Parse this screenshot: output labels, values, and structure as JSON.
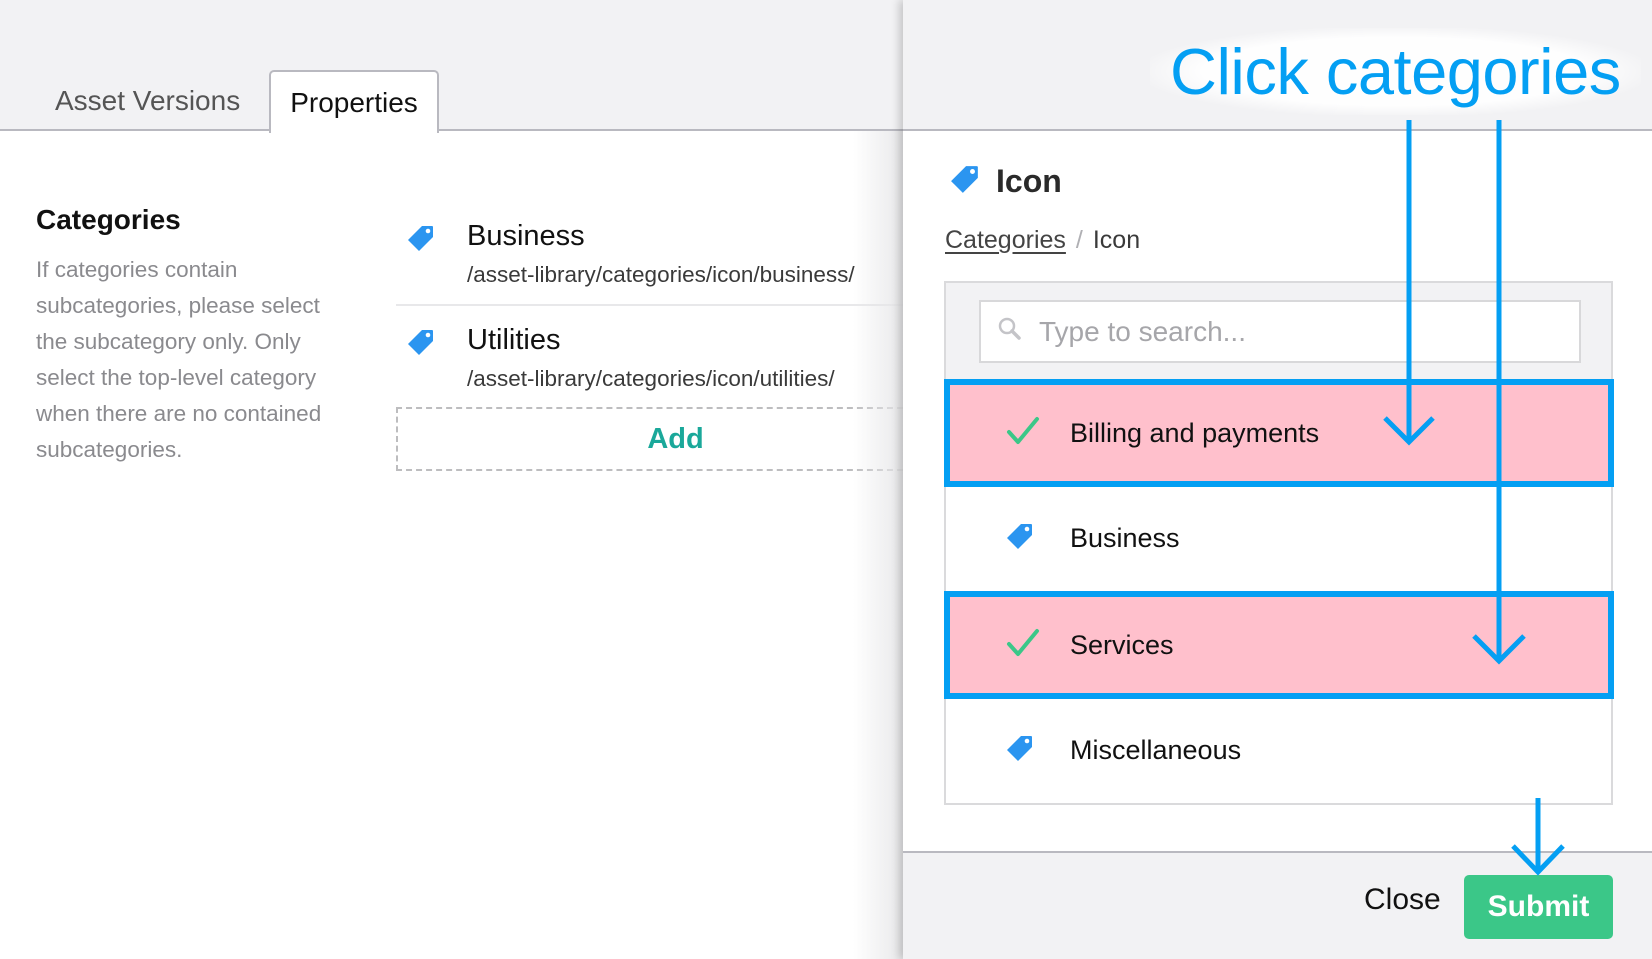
{
  "tabs": [
    {
      "label": "Asset Versions",
      "active": false
    },
    {
      "label": "Properties",
      "active": true
    }
  ],
  "categories_section": {
    "title": "Categories",
    "help_text": "If categories contain subcategories, please select the subcategory only. Only select the top-level category when there are no contained subcategories.",
    "assigned": [
      {
        "name": "Business",
        "path": "/asset-library/categories/icon/business/",
        "icon": "tag-icon"
      },
      {
        "name": "Utilities",
        "path": "/asset-library/categories/icon/utilities/",
        "icon": "tag-icon"
      }
    ],
    "add_label": "Add"
  },
  "drawer": {
    "title": "Icon",
    "title_icon": "tag-icon",
    "breadcrumb": [
      {
        "label": "Categories",
        "link": true
      },
      {
        "label": "Icon",
        "link": false
      }
    ],
    "breadcrumb_separator": "/",
    "search": {
      "placeholder": "Type to search...",
      "value": ""
    },
    "items": [
      {
        "label": "Billing and payments",
        "selected": true,
        "icon": "check-icon"
      },
      {
        "label": "Business",
        "selected": false,
        "icon": "tag-icon"
      },
      {
        "label": "Services",
        "selected": true,
        "icon": "check-icon"
      },
      {
        "label": "Miscellaneous",
        "selected": false,
        "icon": "tag-icon"
      }
    ],
    "close_label": "Close",
    "submit_label": "Submit"
  },
  "annotation": {
    "text": "Click categories"
  },
  "colors": {
    "accent_blue": "#049ff3",
    "tag_blue": "#2b95f0",
    "check_green": "#3bc788",
    "add_teal": "#1aa89a",
    "submit_green": "#3bc788",
    "highlight_pink": "#ffc0cc"
  }
}
